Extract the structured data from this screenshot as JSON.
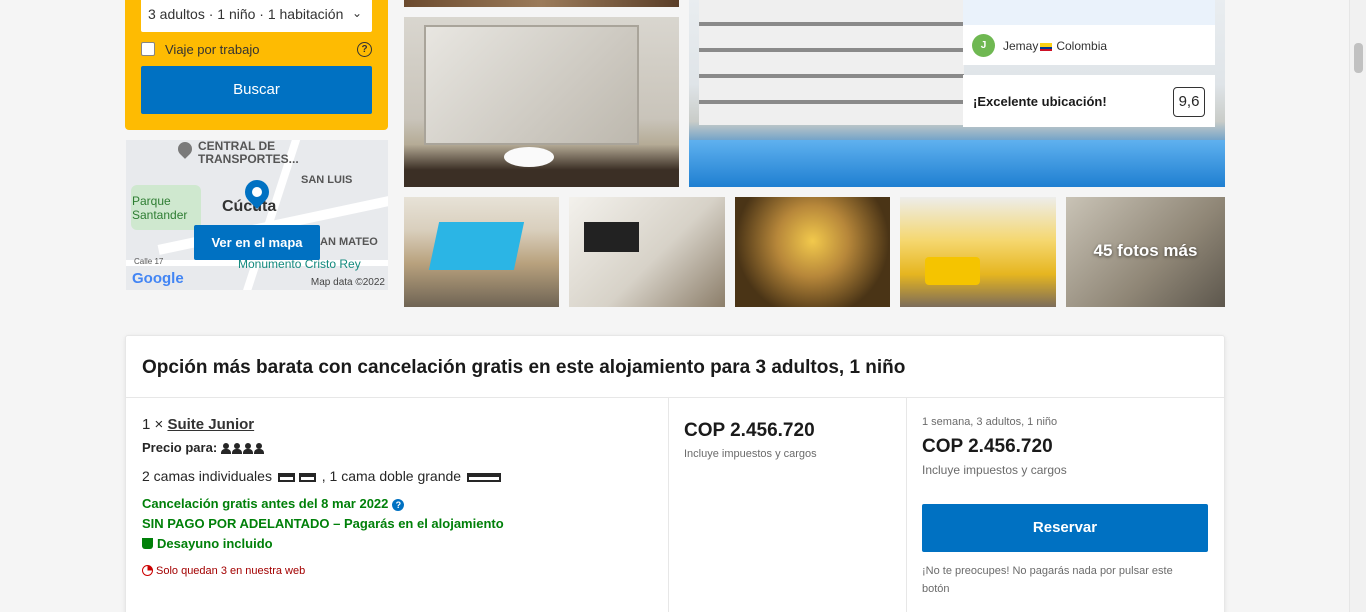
{
  "search": {
    "occupancy_value": "3 adultos · 1 niño · 1 habitación",
    "work_trip_label": "Viaje por trabajo",
    "help_glyph": "?",
    "search_button": "Buscar"
  },
  "map": {
    "labels": {
      "transportes": "CENTRAL DE TRANSPORTES...",
      "san_luis": "SAN LUIS",
      "parque": "Parque Santander",
      "city": "Cúcuta",
      "san_mateo": "AN MATEO",
      "monumento": "Monumento Cristo Rey",
      "calle": "Calle 17"
    },
    "view_map_button": "Ver en el mapa",
    "google_logo": "Google",
    "map_data": "Map data ©2022"
  },
  "gallery": {
    "review": {
      "avatar_letter": "J",
      "reviewer": "Jemay",
      "country": "Colombia"
    },
    "score_text": "¡Excelente ubicación!",
    "score_value": "9,6",
    "more_photos": "45 fotos más"
  },
  "option": {
    "heading": "Opción más barata con cancelación gratis en este alojamiento para 3 adultos, 1 niño",
    "room_qty": "1 ×",
    "room_name": "Suite Junior",
    "price_for_label": "Precio para:",
    "beds_part1": "2 camas individuales",
    "beds_part2": ", 1 cama doble grande",
    "free_cancel": "Cancelación gratis antes del 8 mar 2022",
    "no_prepay": "SIN PAGO POR ADELANTADO – Pagarás en el alojamiento",
    "breakfast": "Desayuno incluido",
    "scarcity": "Solo quedan 3 en nuestra web",
    "price": "COP 2.456.720",
    "price_note": "Incluye impuestos y cargos",
    "stay_summary": "1 semana, 3 adultos, 1 niño",
    "total_price": "COP 2.456.720",
    "total_note": "Incluye impuestos y cargos",
    "reserve_button": "Reservar",
    "reassurance": "¡No te preocupes! No pagarás nada por pulsar este botón"
  },
  "colors": {
    "brand_blue": "#0071c2",
    "search_yellow": "#febb02",
    "success_green": "#008009",
    "alert_red": "#a30000"
  }
}
